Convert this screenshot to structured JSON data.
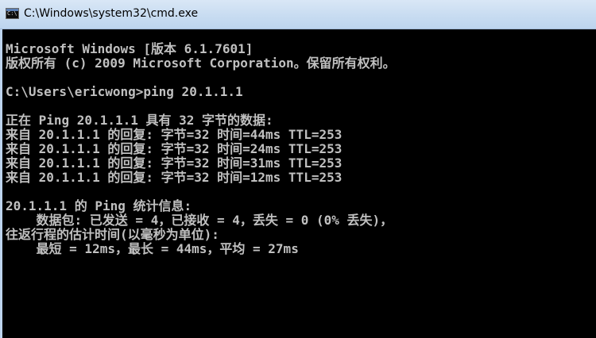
{
  "window": {
    "title": "C:\\Windows\\system32\\cmd.exe",
    "icon_label": "C:\\"
  },
  "console": {
    "lines": [
      "Microsoft Windows [版本 6.1.7601]",
      "版权所有 (c) 2009 Microsoft Corporation。保留所有权利。",
      "",
      "C:\\Users\\ericwong>ping 20.1.1.1",
      "",
      "正在 Ping 20.1.1.1 具有 32 字节的数据:",
      "来自 20.1.1.1 的回复: 字节=32 时间=44ms TTL=253",
      "来自 20.1.1.1 的回复: 字节=32 时间=24ms TTL=253",
      "来自 20.1.1.1 的回复: 字节=32 时间=31ms TTL=253",
      "来自 20.1.1.1 的回复: 字节=32 时间=12ms TTL=253",
      "",
      "20.1.1.1 的 Ping 统计信息:",
      "    数据包: 已发送 = 4，已接收 = 4，丢失 = 0 (0% 丢失)，",
      "往返行程的估计时间(以毫秒为单位):",
      "    最短 = 12ms，最长 = 44ms，平均 = 27ms"
    ]
  },
  "colors": {
    "console_background": "#000000",
    "console_text": "#c0c0c0",
    "titlebar": "#c8dcf1"
  }
}
